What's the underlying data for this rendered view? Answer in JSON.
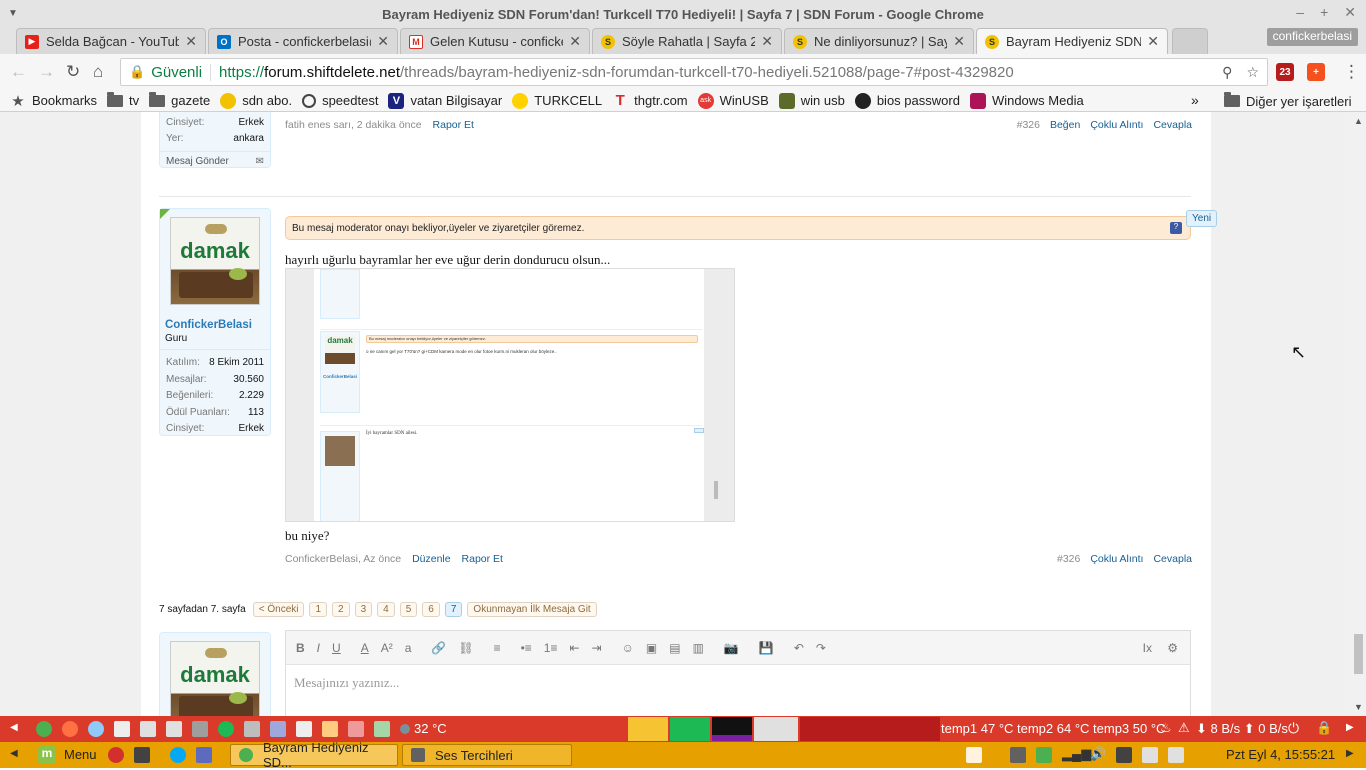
{
  "window": {
    "title": "Bayram Hediyeniz SDN Forum'dan! Turkcell T70 Hediyeli! | Sayfa 7 | SDN Forum - Google Chrome"
  },
  "tabs": [
    {
      "label": "Selda Bağcan - YouTube",
      "color": "#e62117",
      "glyph": "▶"
    },
    {
      "label": "Posta - confickerbelasi@",
      "color": "#0072c6",
      "glyph": "O"
    },
    {
      "label": "Gelen Kutusu - conficke",
      "color": "#d93025",
      "glyph": "M"
    },
    {
      "label": "Söyle Rahatla | Sayfa 2",
      "color": "#f2c200",
      "glyph": "S"
    },
    {
      "label": "Ne dinliyorsunuz? | Say",
      "color": "#f2c200",
      "glyph": "S"
    },
    {
      "label": "Bayram Hediyeniz SDN",
      "color": "#f2c200",
      "glyph": "S"
    }
  ],
  "profile": "confickerbelasi",
  "omnibox": {
    "secure_label": "Güvenli",
    "scheme": "https://",
    "host": "forum.shiftdelete.net",
    "path": "/threads/bayram-hediyeniz-sdn-forumdan-turkcell-t70-hediyeli.521088/page-7#post-4329820"
  },
  "extensions": [
    {
      "label": "23",
      "color": "#b71c1c"
    },
    {
      "label": "+",
      "color": "#f4511e"
    }
  ],
  "bookmarks": [
    {
      "label": "Bookmarks",
      "icon": "star-icon"
    },
    {
      "label": "tv",
      "icon": "folder-icon"
    },
    {
      "label": "gazete",
      "icon": "folder-icon"
    },
    {
      "label": "sdn abo.",
      "icon": "sdn-icon"
    },
    {
      "label": "speedtest",
      "icon": "gauge-icon"
    },
    {
      "label": "vatan Bilgisayar",
      "icon": "vatan-icon"
    },
    {
      "label": "TURKCELL",
      "icon": "turkcell-icon"
    },
    {
      "label": "thgtr.com",
      "icon": "thg-icon"
    },
    {
      "label": "WinUSB",
      "icon": "ask-icon"
    },
    {
      "label": "win usb",
      "icon": "winusb-icon"
    },
    {
      "label": "bios password",
      "icon": "bios-icon"
    },
    {
      "label": "Windows Media",
      "icon": "wmedia-icon"
    }
  ],
  "bookmarks_more": "»",
  "bookmarks_other": "Diğer yer işaretleri",
  "prev_post": {
    "stats": [
      {
        "k": "Cinsiyet:",
        "v": "Erkek"
      },
      {
        "k": "Yer:",
        "v": "ankara"
      }
    ],
    "send_message": "Mesaj Gönder",
    "meta_author": "fatih enes sarı, 2 dakika önce",
    "report": "Rapor Et",
    "number": "#326",
    "like": "Beğen",
    "multiquote": "Çoklu Alıntı",
    "reply": "Cevapla"
  },
  "post": {
    "avatar_text": "damak",
    "username": "ConfickerBelasi",
    "usertitle": "Guru",
    "stats": [
      {
        "k": "Katılım:",
        "v": "8 Ekim 2011"
      },
      {
        "k": "Mesajlar:",
        "v": "30.560"
      },
      {
        "k": "Beğenileri:",
        "v": "2.229"
      },
      {
        "k": "Ödül Puanları:",
        "v": "113"
      },
      {
        "k": "Cinsiyet:",
        "v": "Erkek"
      }
    ],
    "notice": "Bu mesaj moderator onayı bekliyor,üyeler ve ziyaretçiler göremez.",
    "new_badge": "Yeni",
    "text1": "hayırlı uğurlu bayramlar her eve uğur derin dondurucu olsun...",
    "text2": "bu niye?",
    "meta_author": "ConfickerBelasi, Az önce",
    "edit": "Düzenle",
    "report": "Rapor Et",
    "number": "#326",
    "multiquote": "Çoklu Alıntı",
    "reply": "Cevapla"
  },
  "thumbnail": {
    "notice": "Bu mesaj moderator onayı bekliyor,üyeler ve ziyaretçiler göremez.",
    "text": "o ne canım gel yor T70'ün? gi+CDM kamera mode en olur fotoe kurm.ni mukleran olur böyleze..",
    "user1": "ConfickerBelasi",
    "reply2": "İyi bayramlar SDN ailesi."
  },
  "pagination": {
    "label": "7 sayfadan 7. sayfa",
    "prev": "< Önceki",
    "pages": [
      "1",
      "2",
      "3",
      "4",
      "5",
      "6",
      "7"
    ],
    "current": "7",
    "unread": "Okunmayan İlk Mesaja Git"
  },
  "editor": {
    "placeholder": "Mesajınızı yazınız...",
    "tools": [
      "B",
      "I",
      "U",
      "A",
      "A²",
      "a",
      "🔗",
      "⛓",
      "≡",
      "•≡",
      "1≡",
      "⇤",
      "⇥",
      "☺",
      "▣",
      "▤",
      "▥",
      "📷",
      "💾",
      "↶",
      "↷"
    ]
  },
  "panel_top": {
    "temp": "32 °C",
    "sensors": "temp1 47 °C temp2 64 °C temp3 50 °C",
    "net_down": "8 B/s",
    "net_up": "0 B/s"
  },
  "panel_bottom": {
    "menu": "Menu",
    "tasks": [
      {
        "label": "Bayram Hediyeniz SD...",
        "active": true
      },
      {
        "label": "Ses Tercihleri",
        "active": false
      }
    ],
    "clock": "Pzt Eyl  4, 15:55:21"
  }
}
